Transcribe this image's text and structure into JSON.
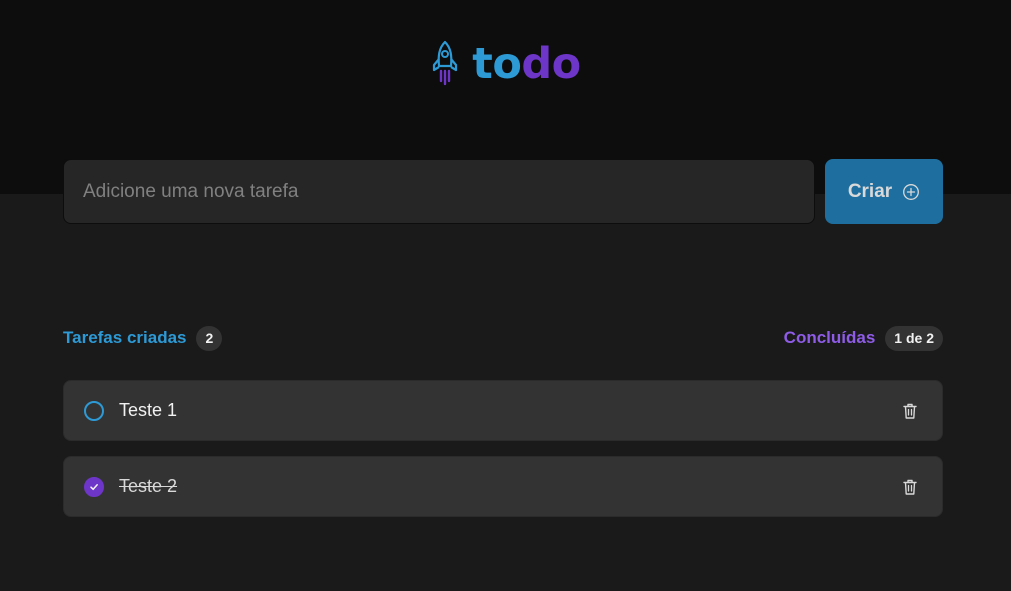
{
  "brand": {
    "logo_icon": "rocket-icon",
    "name_part1": "to",
    "name_part2": "do",
    "colors": {
      "part1": "#2d9ad6",
      "part2": "#6e35c9"
    }
  },
  "create_form": {
    "placeholder": "Adicione uma nova tarefa",
    "value": "",
    "button_label": "Criar",
    "button_icon": "plus-circle-icon"
  },
  "counters": {
    "created_label": "Tarefas criadas",
    "created_count": "2",
    "done_label": "Concluídas",
    "done_count": "1 de 2"
  },
  "tasks": [
    {
      "title": "Teste 1",
      "completed": false
    },
    {
      "title": "Teste 2",
      "completed": true
    }
  ],
  "icons": {
    "checkbox": "circle-checkbox-icon",
    "check": "check-icon",
    "delete": "trash-icon"
  },
  "colors": {
    "accent_blue": "#1e6f9f",
    "accent_purple": "#6e35c9",
    "background": "#1a1a1a",
    "header": "#0d0d0d"
  }
}
